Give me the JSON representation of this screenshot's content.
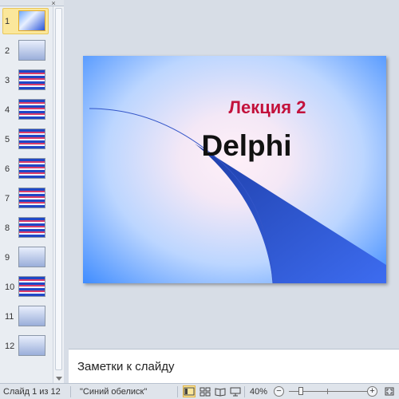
{
  "thumbnails": [
    {
      "num": "1",
      "selected": true,
      "style": "tb-blue"
    },
    {
      "num": "2",
      "selected": false,
      "style": "tb-dark"
    },
    {
      "num": "3",
      "selected": false,
      "style": "tb-mix"
    },
    {
      "num": "4",
      "selected": false,
      "style": "tb-mix"
    },
    {
      "num": "5",
      "selected": false,
      "style": "tb-mix"
    },
    {
      "num": "6",
      "selected": false,
      "style": "tb-mix"
    },
    {
      "num": "7",
      "selected": false,
      "style": "tb-mix"
    },
    {
      "num": "8",
      "selected": false,
      "style": "tb-mix"
    },
    {
      "num": "9",
      "selected": false,
      "style": "tb-dark"
    },
    {
      "num": "10",
      "selected": false,
      "style": "tb-mix"
    },
    {
      "num": "11",
      "selected": false,
      "style": "tb-dark"
    },
    {
      "num": "12",
      "selected": false,
      "style": "tb-dark"
    }
  ],
  "pane_tabs": {
    "close": "×"
  },
  "slide": {
    "title": "Лекция 2",
    "subtitle": "Delphi",
    "title_color": "#c3123c",
    "accent_color": "#2448c8"
  },
  "notes": {
    "placeholder": "Заметки к слайду"
  },
  "status": {
    "slide_info": "Слайд 1 из 12",
    "theme": "\"Синий обелиск\"",
    "zoom": "40%",
    "zoom_out": "−",
    "zoom_in": "+",
    "zoom_level": 0.4
  }
}
